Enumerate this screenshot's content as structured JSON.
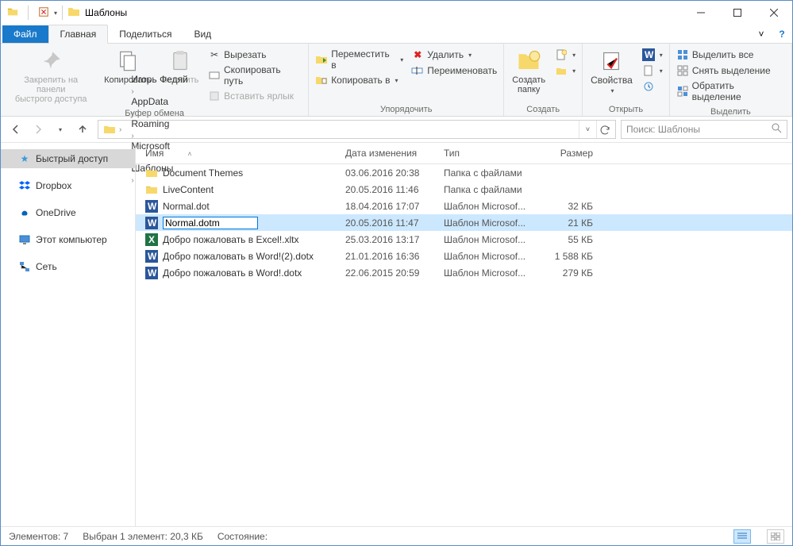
{
  "window": {
    "title": "Шаблоны"
  },
  "tabs": {
    "file": "Файл",
    "home": "Главная",
    "share": "Поделиться",
    "view": "Вид"
  },
  "ribbon": {
    "clipboard": {
      "caption": "Буфер обмена",
      "pin": "Закрепить на панели\nбыстрого доступа",
      "copy": "Копировать",
      "paste": "Вставить",
      "cut": "Вырезать",
      "copypath": "Скопировать путь",
      "pasteshortcut": "Вставить ярлык"
    },
    "organize": {
      "caption": "Упорядочить",
      "moveto": "Переместить в",
      "copyto": "Копировать в",
      "delete": "Удалить",
      "rename": "Переименовать"
    },
    "new": {
      "caption": "Создать",
      "newfolder": "Создать\nпапку"
    },
    "open": {
      "caption": "Открыть",
      "properties": "Свойства"
    },
    "select": {
      "caption": "Выделить",
      "selectall": "Выделить все",
      "selectnone": "Снять выделение",
      "invert": "Обратить выделение"
    }
  },
  "breadcrumbs": [
    "Игорь Федяй",
    "AppData",
    "Roaming",
    "Microsoft",
    "Шаблоны"
  ],
  "search": {
    "placeholder": "Поиск: Шаблоны"
  },
  "nav": {
    "quickaccess": "Быстрый доступ",
    "dropbox": "Dropbox",
    "onedrive": "OneDrive",
    "thispc": "Этот компьютер",
    "network": "Сеть"
  },
  "columns": {
    "name": "Имя",
    "date": "Дата изменения",
    "type": "Тип",
    "size": "Размер"
  },
  "files": [
    {
      "name": "Document Themes",
      "date": "03.06.2016 20:38",
      "type": "Папка с файлами",
      "size": "",
      "icon": "folder",
      "selected": false,
      "rename": false
    },
    {
      "name": "LiveContent",
      "date": "20.05.2016 11:46",
      "type": "Папка с файлами",
      "size": "",
      "icon": "folder",
      "selected": false,
      "rename": false
    },
    {
      "name": "Normal.dot",
      "date": "18.04.2016 17:07",
      "type": "Шаблон Microsof...",
      "size": "32 КБ",
      "icon": "word-old",
      "selected": false,
      "rename": false
    },
    {
      "name": "Normal.dotm",
      "date": "20.05.2016 11:47",
      "type": "Шаблон Microsof...",
      "size": "21 КБ",
      "icon": "word",
      "selected": true,
      "rename": true
    },
    {
      "name": "Добро пожаловать в Excel!.xltx",
      "date": "25.03.2016 13:17",
      "type": "Шаблон Microsof...",
      "size": "55 КБ",
      "icon": "excel",
      "selected": false,
      "rename": false
    },
    {
      "name": "Добро пожаловать в Word!(2).dotx",
      "date": "21.01.2016 16:36",
      "type": "Шаблон Microsof...",
      "size": "1 588 КБ",
      "icon": "word",
      "selected": false,
      "rename": false
    },
    {
      "name": "Добро пожаловать в Word!.dotx",
      "date": "22.06.2015 20:59",
      "type": "Шаблон Microsof...",
      "size": "279 КБ",
      "icon": "word",
      "selected": false,
      "rename": false
    }
  ],
  "status": {
    "count": "Элементов: 7",
    "selection": "Выбран 1 элемент: 20,3 КБ",
    "state": "Состояние:"
  }
}
